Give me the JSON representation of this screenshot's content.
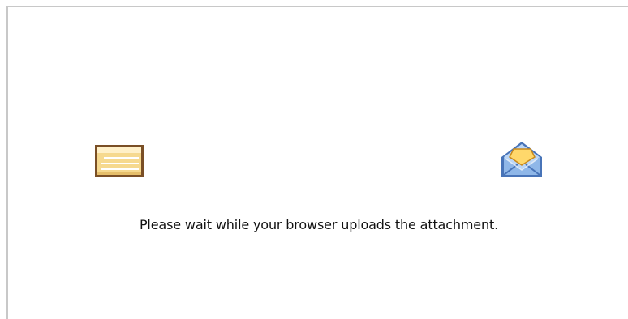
{
  "upload_dialog": {
    "message": "Please wait while your browser uploads the attachment.",
    "icons": {
      "left": "file-icon",
      "right": "open-envelope-icon"
    },
    "colors": {
      "file_fill": "#f6d98f",
      "file_border": "#7a4f26",
      "envelope_fill": "#8fb7e8",
      "envelope_flap": "#ffd86b"
    }
  }
}
